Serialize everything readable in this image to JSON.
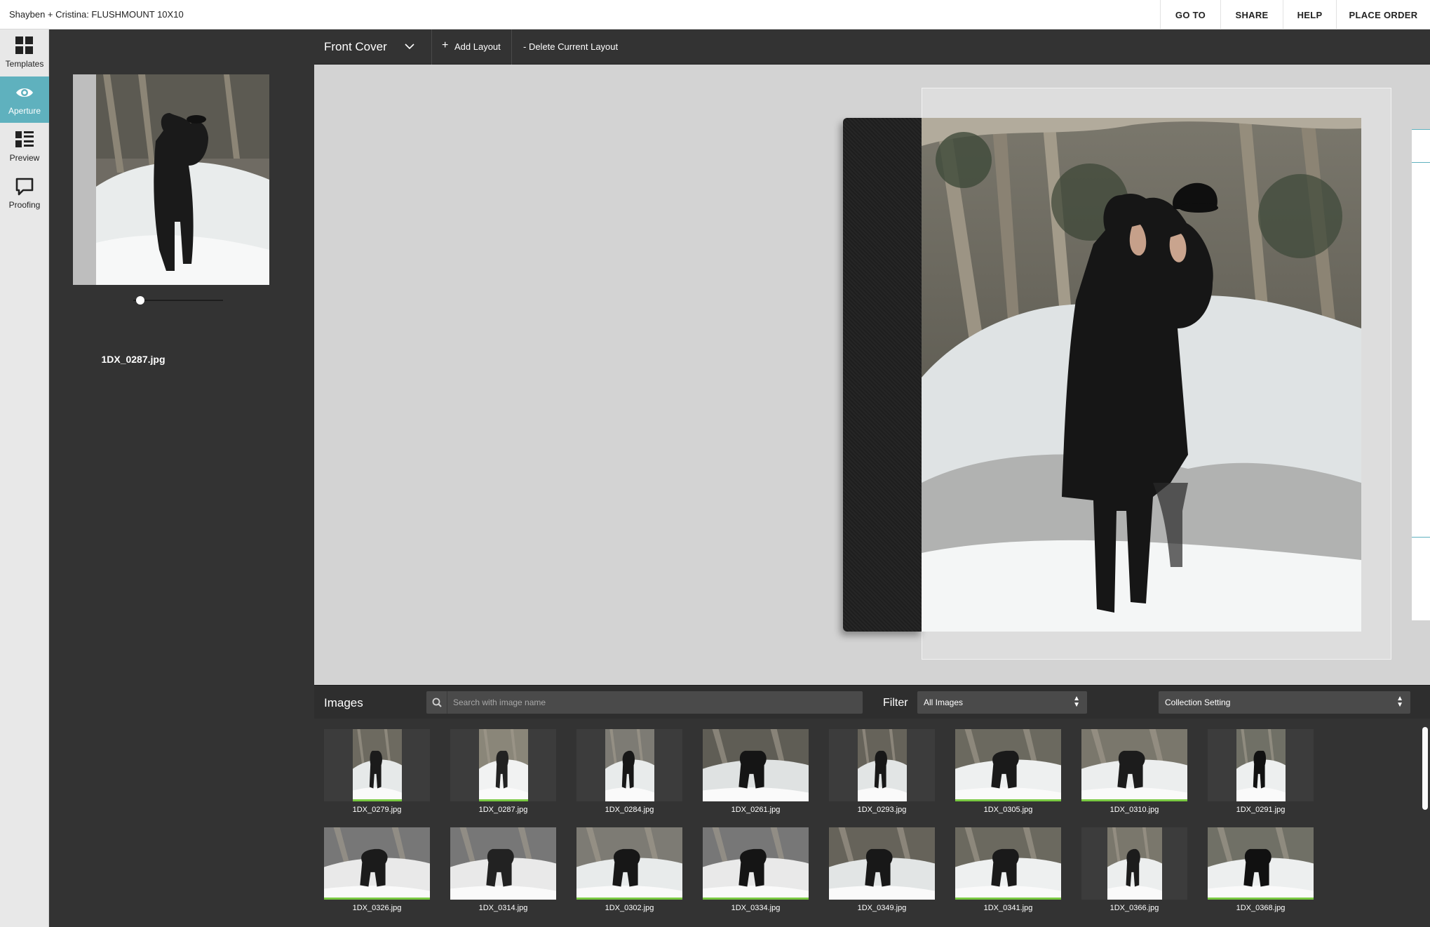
{
  "app": {
    "title": "Shayben + Cristina: FLUSHMOUNT 10X10"
  },
  "top_actions": {
    "go_to": "GO TO",
    "share": "SHARE",
    "help": "HELP",
    "place_order": "PLACE ORDER"
  },
  "left_nav": {
    "templates": "Templates",
    "aperture": "Aperture",
    "preview": "Preview",
    "proofing": "Proofing"
  },
  "side_panel": {
    "filename": "1DX_0287.jpg",
    "zoom_level": 0.08
  },
  "toolbar": {
    "page": "Front Cover",
    "add_layout": "Add Layout",
    "delete_layout": "- Delete Current Layout"
  },
  "images_bar": {
    "title": "Images",
    "search_placeholder": "Search with image name",
    "filter_label": "Filter",
    "filter_value": "All Images",
    "collection_value": "Collection Setting"
  },
  "images": [
    {
      "name": "1DX_0279.jpg",
      "used": true
    },
    {
      "name": "1DX_0287.jpg",
      "used": true
    },
    {
      "name": "1DX_0284.jpg",
      "used": false
    },
    {
      "name": "1DX_0261.jpg",
      "used": false
    },
    {
      "name": "1DX_0293.jpg",
      "used": false
    },
    {
      "name": "1DX_0305.jpg",
      "used": true
    },
    {
      "name": "1DX_0310.jpg",
      "used": true
    },
    {
      "name": "1DX_0291.jpg",
      "used": false
    },
    {
      "name": "1DX_0326.jpg",
      "used": true
    },
    {
      "name": "1DX_0314.jpg",
      "used": false
    },
    {
      "name": "1DX_0302.jpg",
      "used": true
    },
    {
      "name": "1DX_0334.jpg",
      "used": true
    },
    {
      "name": "1DX_0349.jpg",
      "used": false
    },
    {
      "name": "1DX_0341.jpg",
      "used": true
    },
    {
      "name": "1DX_0366.jpg",
      "used": false
    },
    {
      "name": "1DX_0368.jpg",
      "used": true
    }
  ],
  "colors": {
    "accent": "#5fb1be",
    "used_indicator": "#7ac943",
    "panel": "#333333",
    "canvas": "#d3d3d3"
  }
}
